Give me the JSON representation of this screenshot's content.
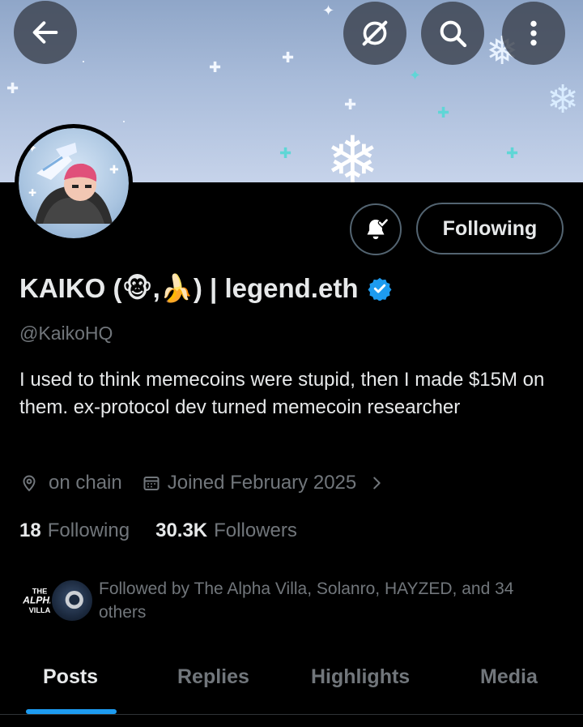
{
  "header": {
    "back_icon": "arrow-left-icon",
    "actions": [
      "grok-icon",
      "search-icon",
      "more-vertical-icon"
    ]
  },
  "profile": {
    "display_name": "KAIKO (🐵,🍌) | legend.eth",
    "verified_badge_icon": "verified-badge-icon",
    "handle": "@KaikoHQ",
    "bio": "I used to think memecoins were stupid, then I made $15M on them.  ex-protocol dev turned memecoin researcher",
    "location": "on chain",
    "joined": "Joined February 2025",
    "following_count": "18",
    "following_label": "Following",
    "followers_count": "30.3K",
    "followers_label": "Followers",
    "notification_icon": "bell-check-icon",
    "follow_button_label": "Following"
  },
  "followed_by": {
    "avatar_text": "THE ALPHA VILLA",
    "text": "Followed by The Alpha Villa, Solanro, HAYZED, and 34 others"
  },
  "tabs": [
    {
      "label": "Posts",
      "active": true
    },
    {
      "label": "Replies",
      "active": false
    },
    {
      "label": "Highlights",
      "active": false
    },
    {
      "label": "Media",
      "active": false
    }
  ],
  "colors": {
    "background": "#000000",
    "text_primary": "#e7e9ea",
    "text_secondary": "#71767b",
    "accent_blue": "#1d9bf0",
    "border": "#536471"
  }
}
